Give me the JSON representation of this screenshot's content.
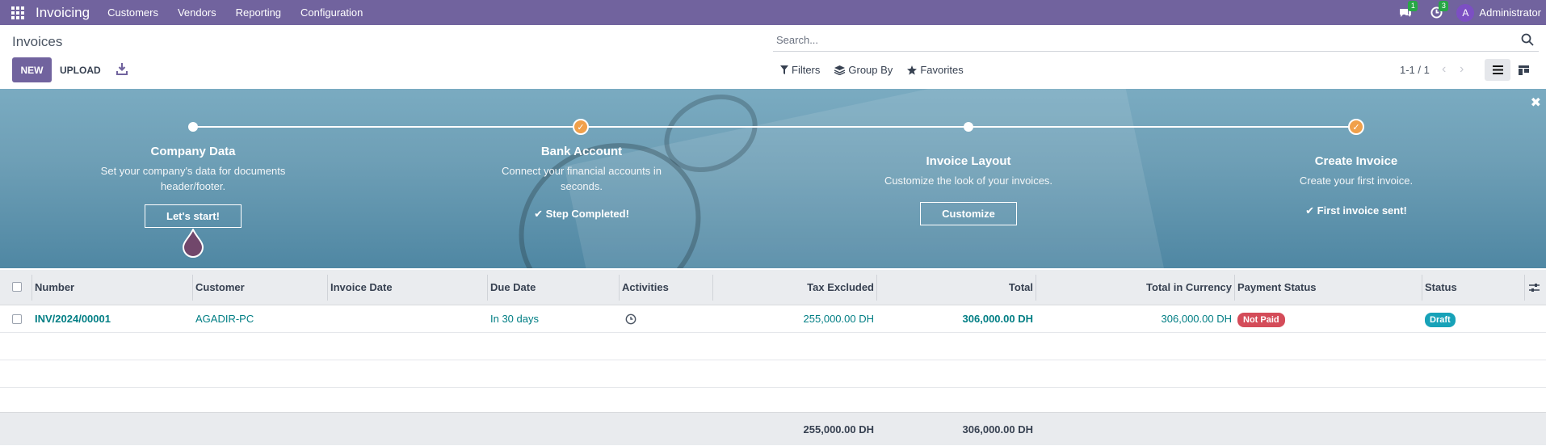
{
  "navbar": {
    "brand": "Invoicing",
    "menu": [
      "Customers",
      "Vendors",
      "Reporting",
      "Configuration"
    ],
    "messages_count": "1",
    "activities_count": "3",
    "avatar_letter": "A",
    "username": "Administrator"
  },
  "control_panel": {
    "title": "Invoices",
    "new_label": "NEW",
    "upload_label": "UPLOAD",
    "search_placeholder": "Search...",
    "filters_label": "Filters",
    "groupby_label": "Group By",
    "favorites_label": "Favorites",
    "pager": "1-1 / 1"
  },
  "banner": {
    "steps": [
      {
        "title": "Company Data",
        "desc": "Set your company's data for documents header/footer.",
        "action": "Let's start!",
        "done": false
      },
      {
        "title": "Bank Account",
        "desc": "Connect your financial accounts in seconds.",
        "action": "Step Completed!",
        "done": true
      },
      {
        "title": "Invoice Layout",
        "desc": "Customize the look of your invoices.",
        "action": "Customize",
        "done": false
      },
      {
        "title": "Create Invoice",
        "desc": "Create your first invoice.",
        "action": "First invoice sent!",
        "done": true
      }
    ]
  },
  "table": {
    "columns": [
      "Number",
      "Customer",
      "Invoice Date",
      "Due Date",
      "Activities",
      "Tax Excluded",
      "Total",
      "Total in Currency",
      "Payment Status",
      "Status"
    ],
    "rows": [
      {
        "number": "INV/2024/00001",
        "customer": "AGADIR-PC",
        "invoice_date": "",
        "due_date": "In 30 days",
        "tax_excluded": "255,000.00 DH",
        "total": "306,000.00 DH",
        "total_currency": "306,000.00 DH",
        "payment_status": "Not Paid",
        "status": "Draft"
      }
    ],
    "totals": {
      "tax_excluded": "255,000.00 DH",
      "total": "306,000.00 DH"
    }
  },
  "colors": {
    "brand": "#71639e",
    "link": "#017e84",
    "not_paid": "#d44c59",
    "draft": "#17a2b8",
    "step_done": "#f0a04b"
  }
}
